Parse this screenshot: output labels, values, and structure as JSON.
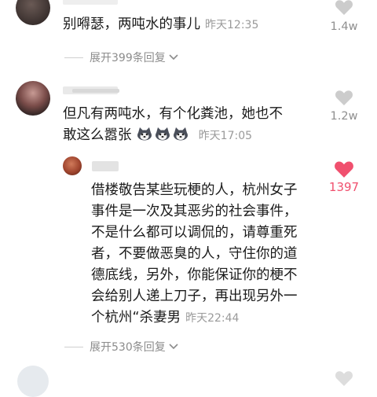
{
  "comments": [
    {
      "text": "别嘚瑟，两吨水的事儿",
      "time": "昨天12:35",
      "likes": "1.4w",
      "expand": "展开399条回复"
    },
    {
      "text_line1": "但凡有两吨水，有个化粪池，她也不",
      "text_line2": "敢这么嚣张",
      "time": "昨天17:05",
      "likes": "1.2w"
    }
  ],
  "reply": {
    "lines": [
      "借楼敬告某些玩梗的人，杭州女子",
      "事件是一次及其恶劣的社会事件，",
      "不是什么都可以调侃的，请尊重死",
      "者，不要做恶臭的人，守住你的道",
      "德底线，另外，你能保证你的梗不",
      "会给别人递上刀子，再出现另外一"
    ],
    "last_line": "个杭州“杀妻男",
    "time": "昨天22:44",
    "likes": "1397",
    "expand": "展开530条回复"
  },
  "colors": {
    "heart_liked": "#f0506e",
    "heart_default": "#cccccc",
    "muted_text": "#9a9a9a"
  },
  "icons": [
    "heart-outline-icon",
    "heart-filled-icon",
    "husky-emoji-icon",
    "chevron-down-icon"
  ]
}
